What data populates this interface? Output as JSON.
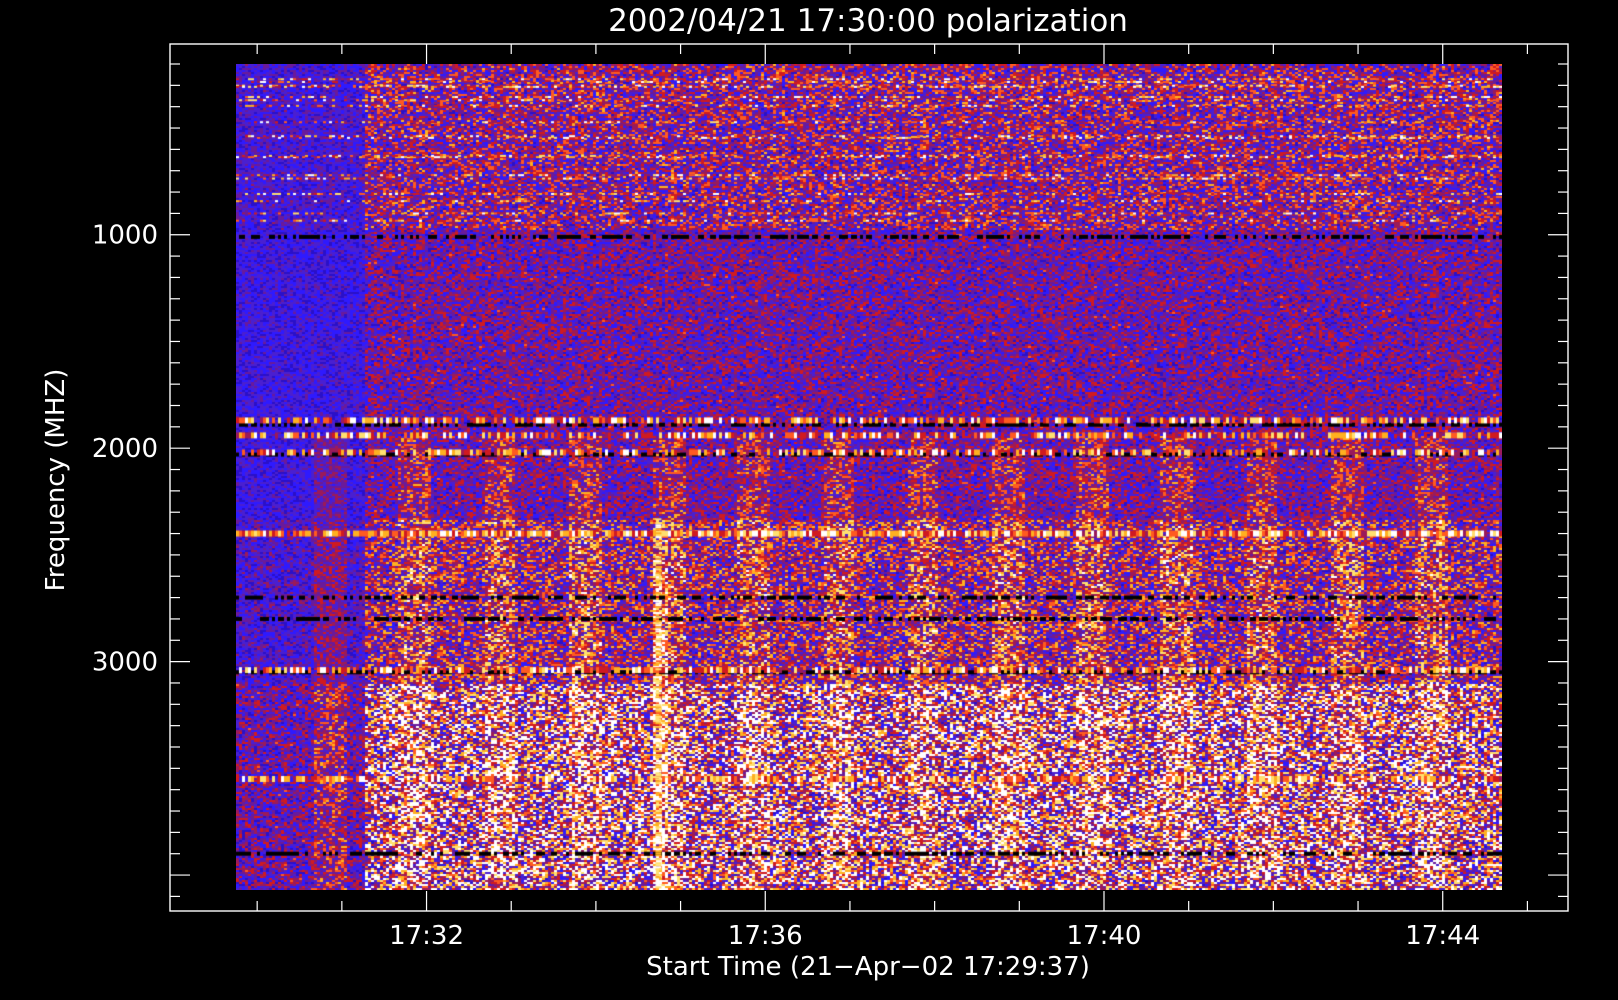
{
  "chart_data": {
    "type": "heatmap",
    "title": "2002/04/21 17:30:00 polarization",
    "xlabel": "Start Time (21−Apr−02 17:29:37)",
    "ylabel": "Frequency (MHZ)",
    "x_ticks": [
      {
        "label": "17:32",
        "minutes": 2.0
      },
      {
        "label": "17:36",
        "minutes": 6.0
      },
      {
        "label": "17:40",
        "minutes": 10.0
      },
      {
        "label": "17:44",
        "minutes": 14.0
      }
    ],
    "y_ticks": [
      {
        "label": "1000",
        "mhz": 1000
      },
      {
        "label": "2000",
        "mhz": 2000
      },
      {
        "label": "3000",
        "mhz": 3000
      }
    ],
    "x_range_minutes": [
      -1.0,
      15.5
    ],
    "data_x_range_minutes": [
      -0.25,
      14.7
    ],
    "y_range_mhz": [
      100,
      4170
    ],
    "data_y_range_mhz": [
      200,
      4070
    ],
    "y_axis_inverted": true,
    "colormap": [
      "#000000",
      "#1a0a3a",
      "#2a10c8",
      "#2e1aff",
      "#4a1fd0",
      "#6a1a9a",
      "#9a1a5a",
      "#d01a20",
      "#ff5a20",
      "#ffb020",
      "#ffe070",
      "#ffffff"
    ],
    "bright_bands_mhz": [
      1870,
      1940,
      2020,
      2400,
      3040,
      3550
    ],
    "dark_bands_mhz": [
      1010,
      1890,
      2030,
      2700,
      2800,
      3050,
      3900
    ],
    "periodic_features_minutes": [
      0.85,
      1.85,
      2.85,
      3.85,
      4.85,
      5.85,
      6.85,
      7.85,
      8.85,
      9.85,
      10.85,
      11.85,
      12.85,
      13.85
    ],
    "burst_minutes": 4.75,
    "colors": {
      "background": "#000000",
      "axes": "#ffffff",
      "base_fill": "#3a1cff"
    }
  }
}
